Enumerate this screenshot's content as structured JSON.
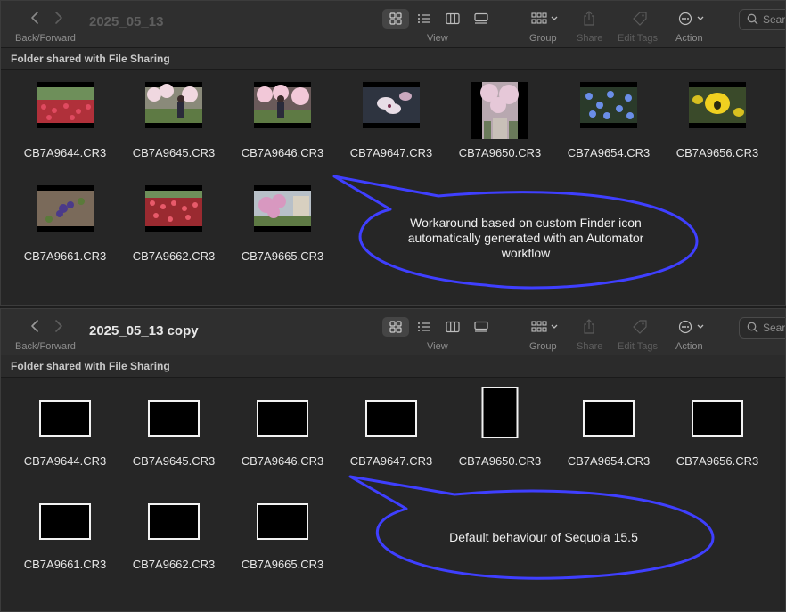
{
  "colors": {
    "callout_stroke": "#3f3fff",
    "callout_fill": "#262626"
  },
  "top_window": {
    "title": "2025_05_13",
    "nav_label": "Back/Forward",
    "view_label": "View",
    "group_label": "Group",
    "share_label": "Share",
    "edit_tags_label": "Edit Tags",
    "action_label": "Action",
    "search_placeholder": "Sear",
    "section_title": "Folder shared with File Sharing",
    "files": [
      {
        "name": "CB7A9644.CR3",
        "thumb": "tulip-field-red"
      },
      {
        "name": "CB7A9645.CR3",
        "thumb": "blossom-tree-person"
      },
      {
        "name": "CB7A9646.CR3",
        "thumb": "blossom-tree-person-2"
      },
      {
        "name": "CB7A9647.CR3",
        "thumb": "magnolia-closeup"
      },
      {
        "name": "CB7A9650.CR3",
        "thumb": "blossom-path-portrait"
      },
      {
        "name": "CB7A9654.CR3",
        "thumb": "forget-me-nots"
      },
      {
        "name": "CB7A9656.CR3",
        "thumb": "yellow-tulip"
      },
      {
        "name": "CB7A9661.CR3",
        "thumb": "purple-flower-ground"
      },
      {
        "name": "CB7A9662.CR3",
        "thumb": "tulip-field-red-2"
      },
      {
        "name": "CB7A9665.CR3",
        "thumb": "magnolia-tree-building"
      }
    ],
    "callout_text": "Workaround based on custom Finder icon automatically generated with an Automator workflow"
  },
  "bottom_window": {
    "title": "2025_05_13 copy",
    "nav_label": "Back/Forward",
    "view_label": "View",
    "group_label": "Group",
    "share_label": "Share",
    "edit_tags_label": "Edit Tags",
    "action_label": "Action",
    "search_placeholder": "Sear",
    "section_title": "Folder shared with File Sharing",
    "files": [
      {
        "name": "CB7A9644.CR3",
        "orientation": "landscape"
      },
      {
        "name": "CB7A9645.CR3",
        "orientation": "landscape"
      },
      {
        "name": "CB7A9646.CR3",
        "orientation": "landscape"
      },
      {
        "name": "CB7A9647.CR3",
        "orientation": "landscape"
      },
      {
        "name": "CB7A9650.CR3",
        "orientation": "portrait"
      },
      {
        "name": "CB7A9654.CR3",
        "orientation": "landscape"
      },
      {
        "name": "CB7A9656.CR3",
        "orientation": "landscape"
      },
      {
        "name": "CB7A9661.CR3",
        "orientation": "landscape"
      },
      {
        "name": "CB7A9662.CR3",
        "orientation": "landscape"
      },
      {
        "name": "CB7A9665.CR3",
        "orientation": "landscape"
      }
    ],
    "callout_text": "Default behaviour of Sequoia 15.5"
  }
}
